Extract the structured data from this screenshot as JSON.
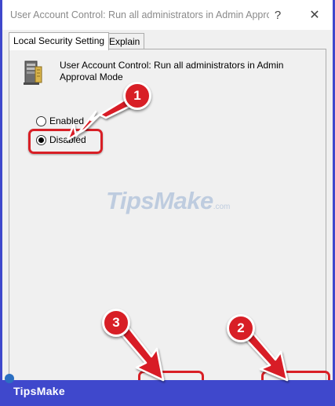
{
  "window": {
    "title": "User Account Control: Run all administrators in Admin Approval Mode Properties",
    "help_glyph": "?",
    "close_glyph": "✕"
  },
  "tabs": [
    {
      "label": "Local Security Setting",
      "active": true
    },
    {
      "label": "Explain",
      "active": false
    }
  ],
  "policy": {
    "title": "User Account Control: Run all administrators in Admin Approval Mode",
    "icon": "server-icon"
  },
  "options": [
    {
      "label": "Enabled",
      "selected": false
    },
    {
      "label": "Disabled",
      "selected": true
    }
  ],
  "annotations": {
    "steps": [
      "1",
      "2",
      "3"
    ],
    "color": "#d81f26"
  },
  "watermark": {
    "text": "TipsMake",
    "suffix": ".com"
  },
  "footer": {
    "brand": "TipsMake",
    "background": "#3f48cc"
  }
}
